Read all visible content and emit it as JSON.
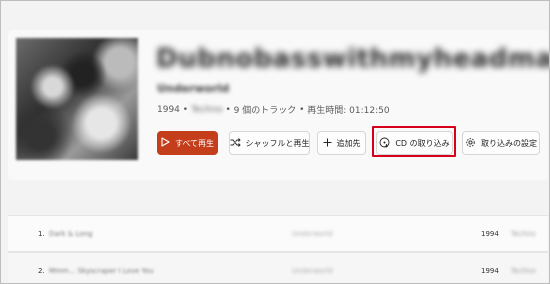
{
  "album": {
    "title": "Dubnobasswithmyheadman",
    "artist": "Underworld",
    "year": "1994",
    "genre": "Techno",
    "track_count": "9 個のトラック",
    "duration": "再生時間: 01:12:50"
  },
  "actions": {
    "play_all": "すべて再生",
    "shuffle": "シャッフルと再生",
    "add_to": "追加先",
    "rip_cd": "CD の取り込み",
    "rip_settings": "取り込みの設定"
  },
  "tracks": [
    {
      "num": "1.",
      "title": "Dark & Long",
      "artist": "Underworld",
      "year": "1994",
      "genre": "Techno"
    },
    {
      "num": "2.",
      "title": "Mmm... Skyscraper I Love You",
      "artist": "Underworld",
      "year": "1994",
      "genre": "Techno"
    }
  ],
  "colors": {
    "accent": "#c43e1c",
    "highlight_box": "#d6001c"
  },
  "icons": {
    "play": "play-icon",
    "shuffle": "shuffle-icon",
    "add": "plus-icon",
    "rip": "cd-rip-icon",
    "settings": "gear-icon"
  }
}
